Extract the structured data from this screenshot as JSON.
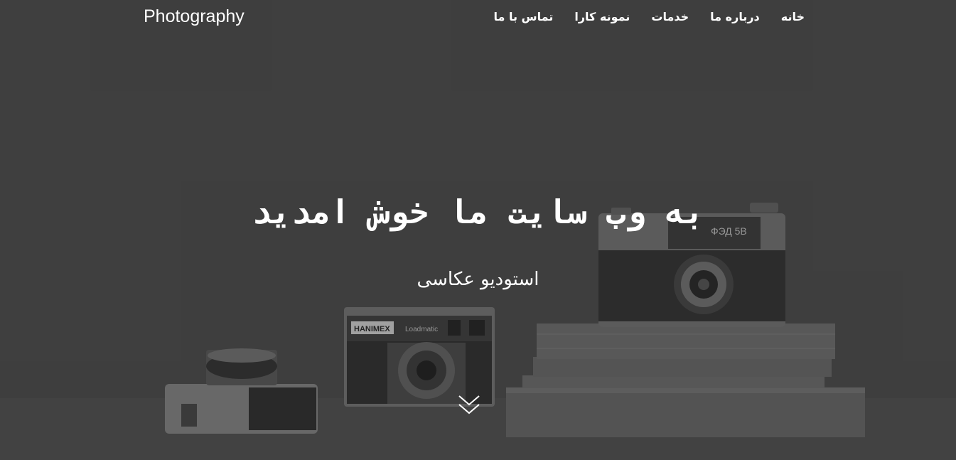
{
  "brand": "Photography",
  "nav": {
    "items": [
      {
        "label": "خانه"
      },
      {
        "label": "درباره ما"
      },
      {
        "label": "خدمات"
      },
      {
        "label": "نمونه کارا"
      },
      {
        "label": "تماس با ما"
      }
    ]
  },
  "hero": {
    "headline": "به وب سایت ما خوش امدید",
    "subheadline": "استودیو عکاسی",
    "camera_brand_1": "HANIMEX",
    "camera_model_1": "Loadmatic",
    "camera_brand_2": "ФЭД 5В",
    "scroll_icon": "chevron-double-down-icon"
  },
  "colors": {
    "overlay": "#4a4a4a",
    "text": "#ffffff"
  }
}
